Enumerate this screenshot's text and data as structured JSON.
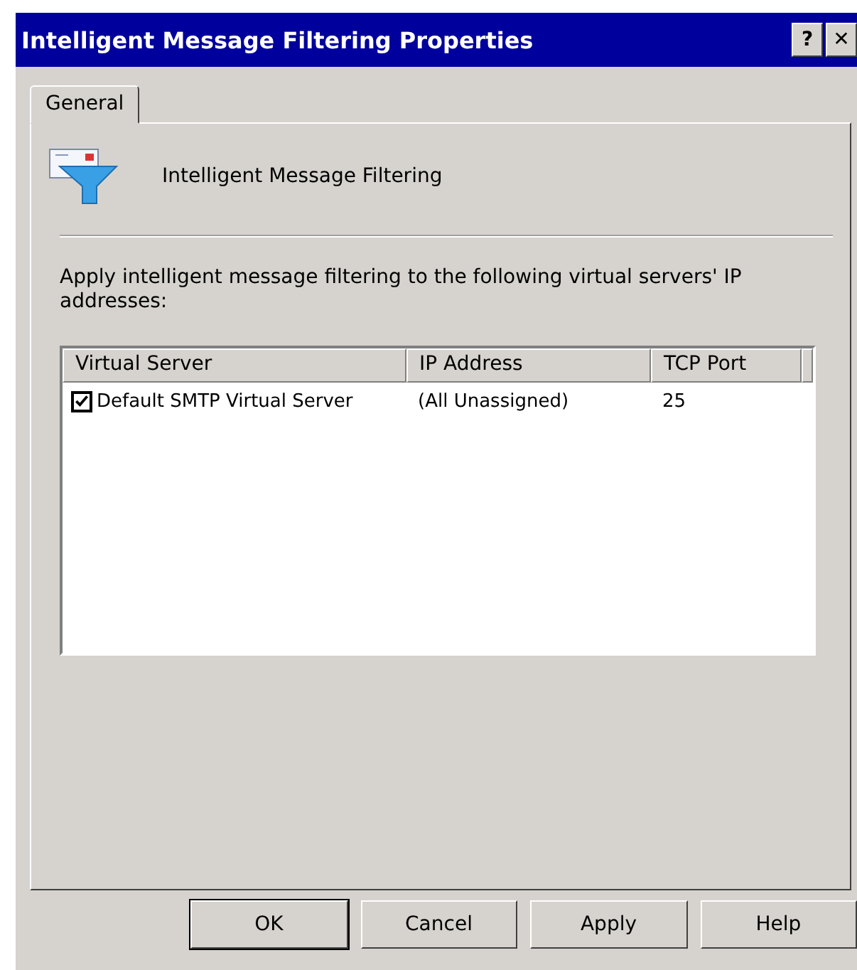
{
  "window": {
    "title": "Intelligent Message Filtering Properties",
    "title_buttons": [
      "?",
      "✕"
    ]
  },
  "tabs": [
    {
      "label": "General",
      "selected": true
    }
  ],
  "header": {
    "label": "Intelligent Message Filtering"
  },
  "description": "Apply intelligent message filtering to the following virtual servers' IP addresses:",
  "table": {
    "columns": [
      "Virtual Server",
      "IP Address",
      "TCP Port"
    ],
    "rows": [
      {
        "checked": true,
        "cells": [
          "Default SMTP Virtual Server",
          "(All Unassigned)",
          "25"
        ]
      }
    ]
  },
  "buttons": [
    {
      "label": "OK",
      "default": true
    },
    {
      "label": "Cancel",
      "default": false
    },
    {
      "label": "Apply",
      "default": false
    },
    {
      "label": "Help",
      "default": false
    }
  ]
}
